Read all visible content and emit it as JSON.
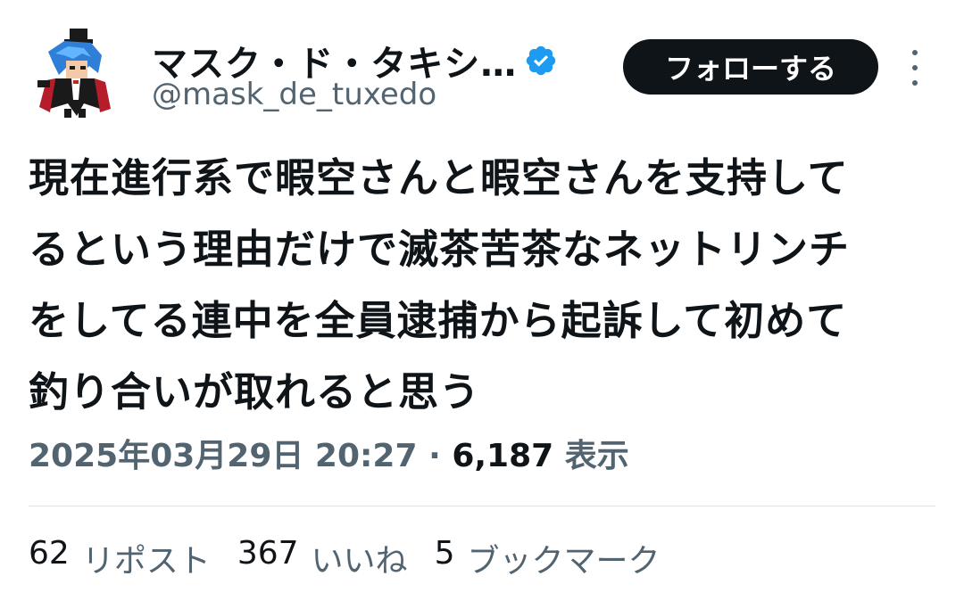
{
  "author": {
    "display_name": "マスク・ド・タキシ…",
    "handle": "@mask_de_tuxedo",
    "verified": true,
    "verified_color": "#1d9bf0"
  },
  "actions": {
    "follow_label": "フォローする",
    "more_icon": "more-vertical-icon"
  },
  "tweet": {
    "text": "現在進行系で暇空さんと暇空さんを支持して\nるという理由だけで滅茶苦茶なネットリンチ\nをしてる連中を全員逮捕から起訴して初めて\n釣り合いが取れると思う",
    "timestamp": "2025年03月29日 20:27",
    "separator": "·",
    "views_count": "6,187",
    "views_label": "表示"
  },
  "stats": [
    {
      "count": "62",
      "label": "リポスト"
    },
    {
      "count": "367",
      "label": "いいね"
    },
    {
      "count": "5",
      "label": "ブックマーク"
    }
  ],
  "colors": {
    "text": "#0f1419",
    "secondary": "#536471",
    "button_bg": "#0f1419",
    "divider": "#dfe3e6"
  }
}
